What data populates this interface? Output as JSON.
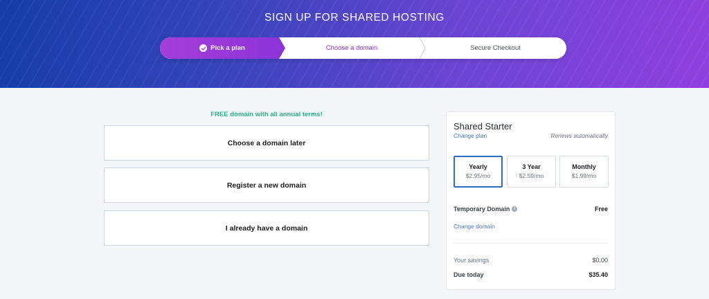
{
  "header": {
    "title": "SIGN UP FOR SHARED HOSTING"
  },
  "steps": [
    {
      "label": "Pick a plan",
      "state": "done"
    },
    {
      "label": "Choose a domain",
      "state": "active"
    },
    {
      "label": "Secure Checkout",
      "state": "upcoming"
    }
  ],
  "domain": {
    "promo": "FREE domain with all annual terms!",
    "options": [
      "Choose a domain later",
      "Register a new domain",
      "I already have a domain"
    ]
  },
  "summary": {
    "plan_name": "Shared Starter",
    "change_plan": "Change plan",
    "renews": "Renews automatically",
    "terms": [
      {
        "label": "Yearly",
        "price": "$2.95/mo",
        "selected": true
      },
      {
        "label": "3 Year",
        "price": "$2.59/mo",
        "selected": false
      },
      {
        "label": "Monthly",
        "price": "$1.99/mo",
        "selected": false
      }
    ],
    "temp_domain_label": "Temporary Domain",
    "temp_domain_value": "Free",
    "change_domain": "Change domain",
    "savings_label": "Your savings",
    "savings_value": "$0.00",
    "due_label": "Due today",
    "due_value": "$35.40"
  },
  "colors": {
    "accent_purple": "#8c2fd6",
    "promo_green": "#27b48c",
    "link_blue": "#4a78c8",
    "selected_border": "#2e6bc6"
  },
  "icons": {
    "step_done": "check-circle-icon",
    "temp_domain_info": "info-icon"
  }
}
